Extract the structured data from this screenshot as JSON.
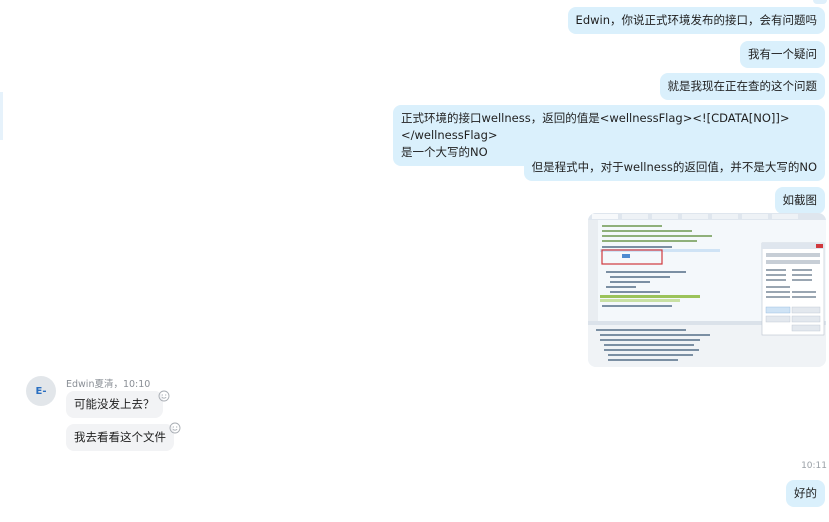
{
  "messages_out": [
    {
      "id": "m1",
      "text": "Edwin，你说正式环境发布的接口，会有问题吗"
    },
    {
      "id": "m2",
      "text": "我有一个疑问"
    },
    {
      "id": "m3",
      "text": "就是我现在正在查的这个问题"
    },
    {
      "id": "m4",
      "line1": "正式环境的接口wellness，返回的值是<wellnessFlag><![CDATA[NO]]></wellnessFlag>",
      "line2": "是一个大写的NO"
    },
    {
      "id": "m5",
      "text": "但是程式中，对于wellness的返回值，并不是大写的NO"
    },
    {
      "id": "m6",
      "text": "如截图"
    }
  ],
  "incoming": {
    "avatar_text": "E-",
    "sender_line": "Edwin夏清，10:10",
    "messages": [
      {
        "text": "可能没发上去？"
      },
      {
        "text": "我去看看这个文件"
      }
    ]
  },
  "reply": {
    "time": "10:11",
    "text": "好的"
  },
  "screenshot_thumb": {
    "icon": "ide-screenshot-thumbnail",
    "highlight_color": "#d0393e",
    "accent": "#9bc35a"
  },
  "colors": {
    "bubble_out": "#daf0fc",
    "bubble_in": "#f2f3f5",
    "meta_text": "#8a8f96"
  }
}
